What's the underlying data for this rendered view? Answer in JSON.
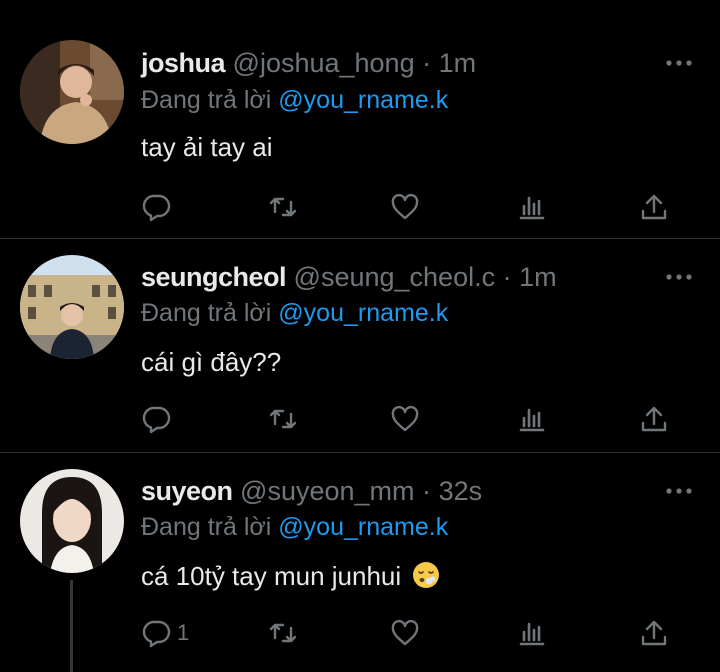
{
  "colors": {
    "background": "#000000",
    "text": "#e7e9ea",
    "muted": "#71767b",
    "accent": "#1d9bf0",
    "divider": "#2f3336"
  },
  "tweets": [
    {
      "name": "joshua",
      "handle": "@joshua_hong",
      "dot": "·",
      "time": "1m",
      "reply_prefix": "Đang trả lời",
      "reply_to": "@you_rname.k",
      "text": "tay ải tay ai",
      "reply_count": ""
    },
    {
      "name": "seungcheol",
      "handle": "@seung_cheol.c",
      "dot": "·",
      "time": "1m",
      "reply_prefix": "Đang trả lời",
      "reply_to": "@you_rname.k",
      "text": "cái gì đây??",
      "reply_count": ""
    },
    {
      "name": "suyeon",
      "handle": "@suyeon_mm",
      "dot": "·",
      "time": "32s",
      "reply_prefix": "Đang trả lời",
      "reply_to": "@you_rname.k",
      "text": "cá 10tỷ tay mun junhui",
      "emoji": "face-exhaling-emoji",
      "reply_count": "1"
    }
  ],
  "icons": [
    "reply-icon",
    "retweet-icon",
    "like-icon",
    "analytics-icon",
    "share-icon",
    "more-icon"
  ]
}
